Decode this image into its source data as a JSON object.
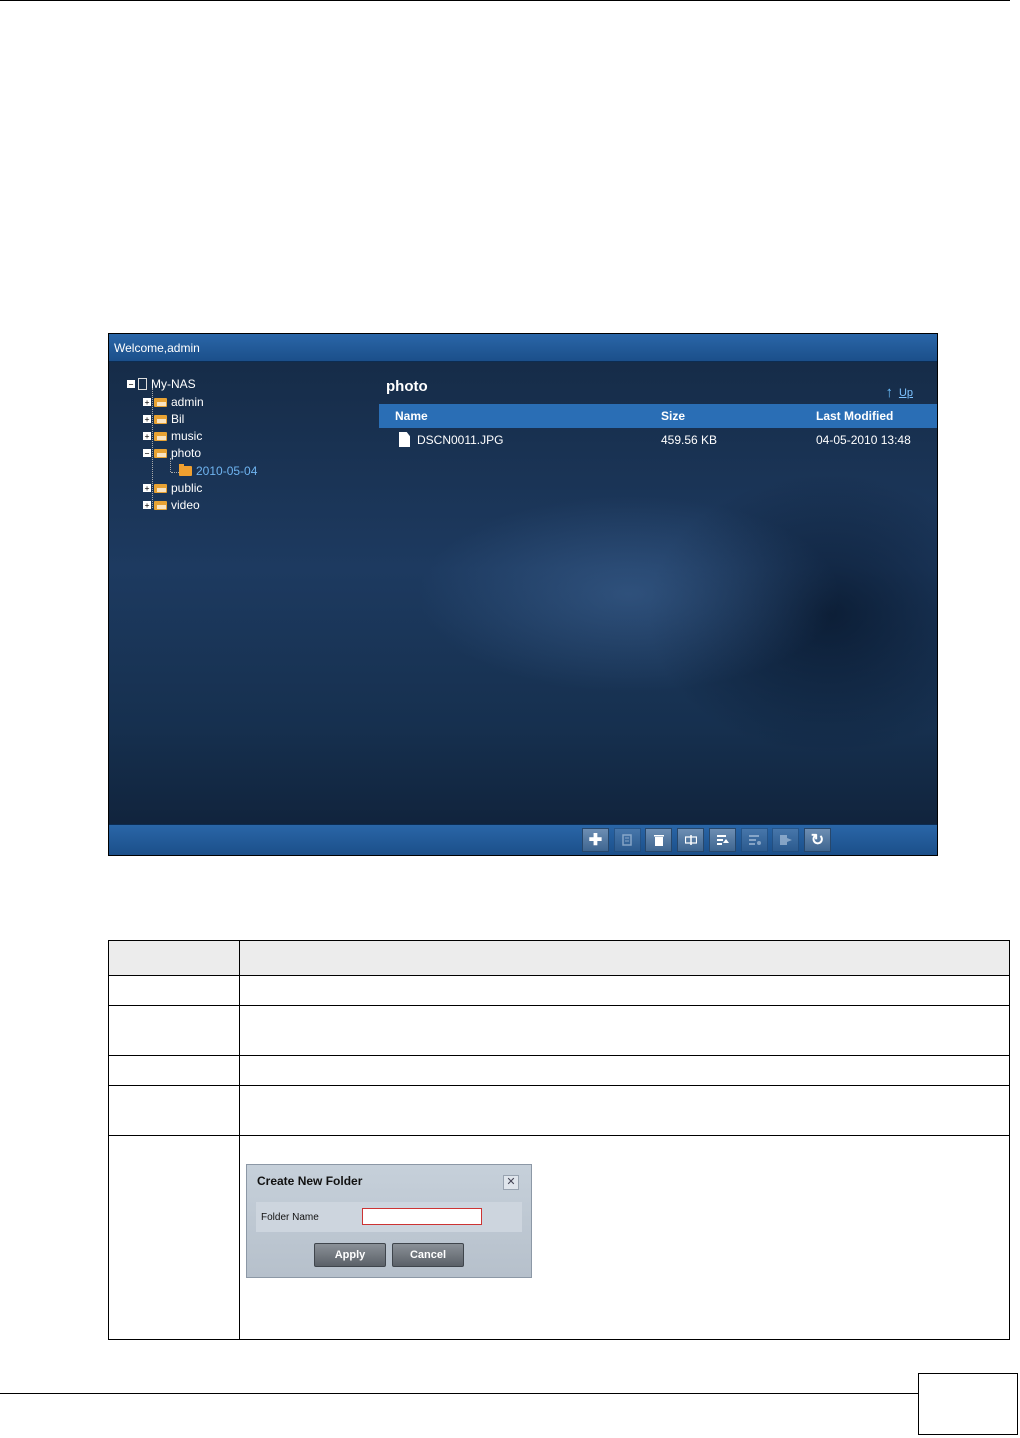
{
  "app": {
    "welcome": "Welcome,admin",
    "tree": [
      {
        "label": "My-NAS",
        "type": "device",
        "toggle": "−"
      },
      {
        "label": "admin",
        "type": "share",
        "toggle": "+"
      },
      {
        "label": "Bil",
        "type": "share",
        "toggle": "+"
      },
      {
        "label": "music",
        "type": "share",
        "toggle": "+"
      },
      {
        "label": "photo",
        "type": "share",
        "toggle": "−"
      },
      {
        "label": "2010-05-04",
        "type": "folder",
        "toggle": ""
      },
      {
        "label": "public",
        "type": "share",
        "toggle": "+"
      },
      {
        "label": "video",
        "type": "share",
        "toggle": "+"
      }
    ],
    "folder_title": "photo",
    "up_label": "Up",
    "columns": {
      "name": "Name",
      "size": "Size",
      "modified": "Last Modified"
    },
    "files": [
      {
        "name": "DSCN0011.JPG",
        "size": "459.56 KB",
        "modified": "04-05-2010 13:48"
      }
    ],
    "toolbar": [
      {
        "icon": "plus-icon",
        "enabled": true
      },
      {
        "icon": "edit-icon",
        "enabled": false
      },
      {
        "icon": "trash-icon",
        "enabled": true
      },
      {
        "icon": "rename-icon",
        "enabled": true
      },
      {
        "icon": "upload-icon",
        "enabled": true
      },
      {
        "icon": "list-icon",
        "enabled": false
      },
      {
        "icon": "move-icon",
        "enabled": false
      },
      {
        "icon": "refresh-icon",
        "enabled": true
      }
    ]
  },
  "dialog": {
    "title": "Create New Folder",
    "close": "✕",
    "field_label": "Folder Name",
    "field_value": "",
    "apply": "Apply",
    "cancel": "Cancel"
  },
  "colors": {
    "title_bar": "#1b4f8a",
    "header_row": "#2a6eb5",
    "selected_tree": "#6fb4f0",
    "folder": "#f0a030"
  }
}
